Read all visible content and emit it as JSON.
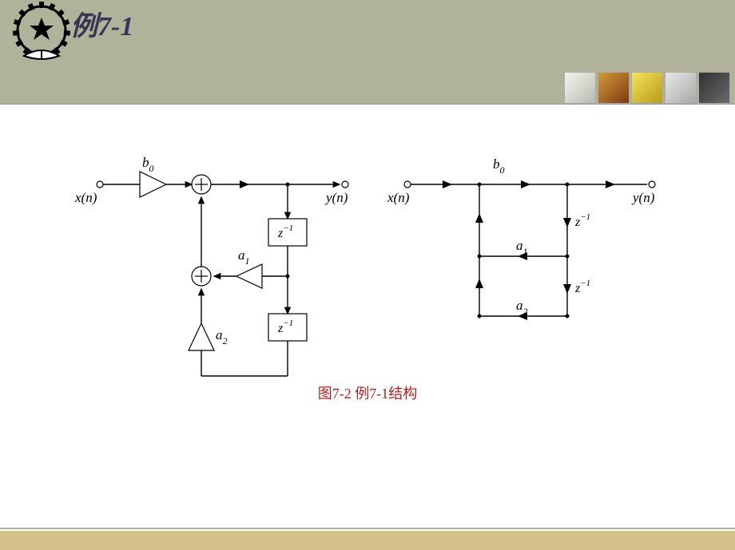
{
  "title": "例7-1",
  "caption": "图7-2   例7-1结构",
  "diagram": {
    "left": {
      "input": "x(n)",
      "output": "y(n)",
      "gain_top": "b",
      "gain_top_sub": "0",
      "coef1": "a",
      "coef1_sub": "1",
      "coef2": "a",
      "coef2_sub": "2",
      "delay": "z",
      "delay_sup": "−1"
    },
    "right": {
      "input": "x(n)",
      "output": "y(n)",
      "gain_top": "b",
      "gain_top_sub": "0",
      "coef1": "a",
      "coef1_sub": "1",
      "coef2": "a",
      "coef2_sub": "2",
      "delay": "z",
      "delay_sup": "−1"
    }
  }
}
